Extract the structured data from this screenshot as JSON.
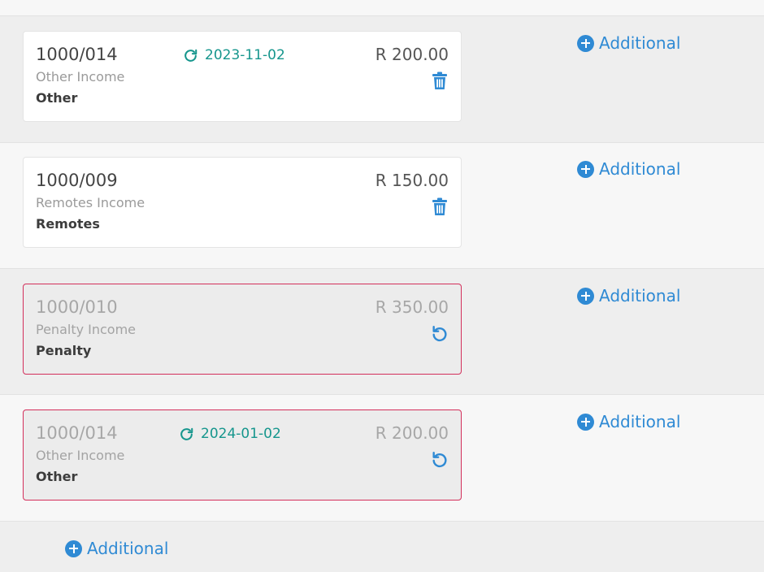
{
  "rows": [
    {
      "code": "1000/014",
      "recur_date": "2023-11-02",
      "amount": "R 200.00",
      "sub": "Other Income",
      "name": "Other",
      "state": "active",
      "action_icon": "trash-icon",
      "add_label": "Additional"
    },
    {
      "code": "1000/009",
      "amount": "R 150.00",
      "sub": "Remotes Income",
      "name": "Remotes",
      "state": "active",
      "action_icon": "trash-icon",
      "add_label": "Additional"
    },
    {
      "code": "1000/010",
      "amount": "R 350.00",
      "sub": "Penalty Income",
      "name": "Penalty",
      "state": "deleted",
      "action_icon": "undo-icon",
      "add_label": "Additional"
    },
    {
      "code": "1000/014",
      "recur_date": "2024-01-02",
      "amount": "R 200.00",
      "sub": "Other Income",
      "name": "Other",
      "state": "deleted",
      "action_icon": "undo-icon",
      "add_label": "Additional"
    }
  ],
  "footer": {
    "add_label": "Additional"
  },
  "colors": {
    "accent": "#2f8ad4",
    "recurring": "#16968d",
    "deleted_border": "#d32f5b"
  }
}
